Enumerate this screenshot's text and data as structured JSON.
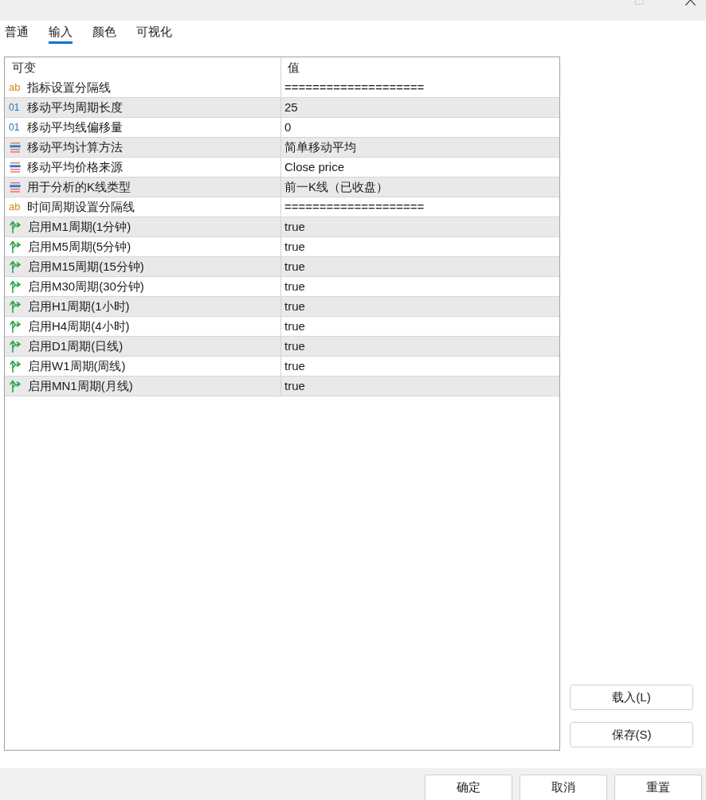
{
  "tabs": [
    {
      "label": "普通",
      "selected": false
    },
    {
      "label": "输入",
      "selected": true
    },
    {
      "label": "颜色",
      "selected": false
    },
    {
      "label": "可视化",
      "selected": false
    }
  ],
  "table": {
    "columns": [
      "可变",
      "值"
    ],
    "rows": [
      {
        "kind": "string",
        "type_mark": "ab",
        "name": "指标设置分隔线",
        "value": "===================="
      },
      {
        "kind": "int",
        "type_mark": "01",
        "name": "移动平均周期长度",
        "value": "25"
      },
      {
        "kind": "int",
        "type_mark": "01",
        "name": "移动平均线偏移量",
        "value": "0"
      },
      {
        "kind": "enum",
        "name": "移动平均计算方法",
        "value": "简单移动平均"
      },
      {
        "kind": "enum",
        "name": "移动平均价格来源",
        "value": "Close price"
      },
      {
        "kind": "enum",
        "name": "用于分析的K线类型",
        "value": "前一K线（已收盘）"
      },
      {
        "kind": "string",
        "type_mark": "ab",
        "name": "时间周期设置分隔线",
        "value": "===================="
      },
      {
        "kind": "bool",
        "name": "启用M1周期(1分钟)",
        "value": "true"
      },
      {
        "kind": "bool",
        "name": "启用M5周期(5分钟)",
        "value": "true"
      },
      {
        "kind": "bool",
        "name": "启用M15周期(15分钟)",
        "value": "true"
      },
      {
        "kind": "bool",
        "name": "启用M30周期(30分钟)",
        "value": "true"
      },
      {
        "kind": "bool",
        "name": "启用H1周期(1小时)",
        "value": "true"
      },
      {
        "kind": "bool",
        "name": "启用H4周期(4小时)",
        "value": "true"
      },
      {
        "kind": "bool",
        "name": "启用D1周期(日线)",
        "value": "true"
      },
      {
        "kind": "bool",
        "name": "启用W1周期(周线)",
        "value": "true"
      },
      {
        "kind": "bool",
        "name": "启用MN1周期(月线)",
        "value": "true"
      }
    ]
  },
  "side_buttons": [
    "载入(L)",
    "保存(S)"
  ],
  "footer_buttons": [
    "确定",
    "取消",
    "重置"
  ]
}
